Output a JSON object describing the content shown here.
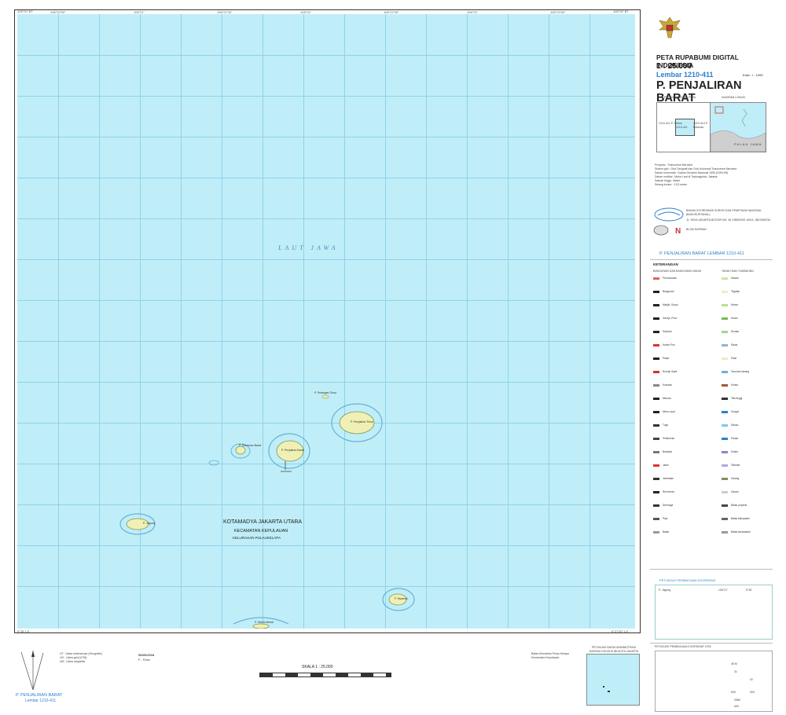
{
  "header": {
    "series": "PETA RUPABUMI DIGITAL INDONESIA",
    "scale": "1 : 25.000",
    "sheet": "Lembar 1210-411",
    "edition": "Edisi : I - 1999",
    "title": "P. PENJALIRAN BARAT",
    "sheet_footer": "P. PENJALIRAN BARAT LEMBAR 1210-411"
  },
  "colors": {
    "sea": "#bfeef8",
    "grid": "#8fd2ea",
    "island": "#f0f0b4",
    "reef": "#6ab0d8",
    "title_blue": "#2d7fd0"
  },
  "map": {
    "sea_name": "LAUT JAWA",
    "admin": [
      "KOTAMADYA JAKARTA UTARA",
      "KECAMATAN KEPULAUAN",
      "KELURAHAN PULAUKELAPA"
    ],
    "islands": [
      {
        "id": "pelangan-timur",
        "label": "P. Pelangan Timur"
      },
      {
        "id": "penjaliran-timur",
        "label": "P. Penjaliran Timur"
      },
      {
        "id": "penjaliran-barat",
        "label": "P. Penjaliran Barat"
      },
      {
        "id": "peteloran-barat",
        "label": "P. Peteloran Barat"
      },
      {
        "id": "jagung",
        "label": "P. Jagung"
      },
      {
        "id": "nyamuk",
        "label": "P. Nyamuk"
      },
      {
        "id": "sebira",
        "label": "P. Sebira Besar"
      }
    ],
    "top_ticks": [
      "106°20'",
      "106°20'30\"",
      "106°21'",
      "106°21'30\"",
      "106°22'",
      "106°22'30\"",
      "106°23'",
      "106°23'30\"",
      "106°24'",
      "106°24'30\"",
      "106°25'"
    ],
    "corner_labels": {
      "top_left": "106°20' BT",
      "top_right": "106°25' BT",
      "bottom_left": "5°25' LS",
      "bottom_right": "5°27'30\" LS"
    }
  },
  "panel": {
    "index_titles": [
      "PETUNJUK LETAK PETA",
      "DIAGRAM LOKASI"
    ],
    "index_cells": [
      "1210-412 P. Sebira",
      "1210-414 P. Belanda",
      "1210-411"
    ],
    "index_place": "PULAU JAWA",
    "meta": [
      "Proyeksi : Transverse Mercator",
      "Sistem grid : Grid Geografi dan Grid Universal Transverse Mercator",
      "Datum horizontal : Datum Geodesi Nasional 1995 (DGN-95)",
      "Datum vertikal : Muka Laut di Tanjungpriok, Jakarta",
      "Satuan tinggi : Meter",
      "Selang kontur : 12,5 meter"
    ],
    "agency1": "BADAN KOORDINASI SURVEI DAN PEMETAAN NASIONAL (BAKOSURTANAL)",
    "agency1_addr": "JL. RAYA JAKARTA-BOGOR KM. 46 CIBINONG 16911, INDONESIA",
    "agency2": "BLOM NORWAY",
    "legend_title": "KETERANGAN",
    "legend_cols": [
      "BANGUNAN DAN BANGUNAN UMUM",
      "TANAH DAN TUMBUHAN"
    ],
    "legend_left": [
      "Permukiman",
      "Bangunan",
      "Masjid, Surau",
      "Gereja, Pura",
      "Sekolah",
      "Kantor Pos",
      "Pasar",
      "Rumah Sakit",
      "Kuburan",
      "Menara",
      "Mercu suar",
      "Tugu",
      "Pelabuhan",
      "Bandara",
      "Jalan",
      "Jembatan",
      "Rel kereta",
      "Dermaga",
      "Pipa",
      "Batas"
    ],
    "legend_right": [
      "Sawah",
      "Tegalan",
      "Kebun",
      "Hutan",
      "Semak",
      "Rawa",
      "Pasir",
      "Terumbu karang",
      "Kontur",
      "Titik tinggi",
      "Sungai",
      "Danau",
      "Pantai",
      "Kolam",
      "Tambak",
      "Karang",
      "Garam",
      "Batas propinsi",
      "Batas kabupaten",
      "Batas kecamatan"
    ],
    "gazetteer_title": "PETUNJUK PEMBACAAN KOORDINAT",
    "gazetteer_cols": [
      "P. Jagung",
      "106°21'",
      "5°26'"
    ],
    "utm_title": "PETUNJUK PEMBACAAN KOORDINAT UTM",
    "utm_values": [
      "48 M",
      "31",
      "92",
      "690",
      "900",
      "9380",
      "600"
    ],
    "admin_inset_title": "PETUNJUK BATAS ADMINISTRASI DAERAH KHUSUS IBUKOTA JAKARTA"
  },
  "bottom": {
    "scale_label": "SKALA 1 : 25.000",
    "sheet_label": "P. PENJALIRAN BARAT",
    "sheet_code": "Lembar 1210-411",
    "notes": [
      "UT : Utara sebenarnya (Geografis)",
      "UG : Utara grid (UTM)",
      "UM : Utara magnetis"
    ],
    "abbrev_title": "SINGKATAN",
    "abbrev": [
      "P. : Pulau"
    ],
    "legend_small": [
      "Batas Kelurahan Pulau Kelapa",
      "Kecamatan Kepulauan"
    ]
  }
}
